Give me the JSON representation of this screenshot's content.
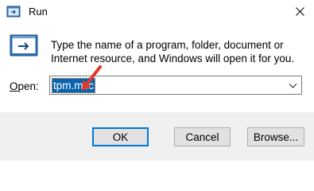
{
  "window": {
    "title": "Run",
    "icons": {
      "app": "run-app-icon",
      "close": "close-icon",
      "dialog": "run-dialog-icon",
      "dropdown": "chevron-down-icon"
    }
  },
  "dialog": {
    "description": "Type the name of a program, folder, document or Internet resource, and Windows will open it for you.",
    "open_label_prefix": "",
    "open_label_mnemonic": "O",
    "open_label_rest": "pen:",
    "open_value": "tpm.msc"
  },
  "buttons": {
    "ok": "OK",
    "cancel": "Cancel",
    "browse": "Browse..."
  },
  "colors": {
    "selection": "#0a64ad",
    "accent": "#0078d7",
    "annotation_arrow": "#e03a2f"
  }
}
